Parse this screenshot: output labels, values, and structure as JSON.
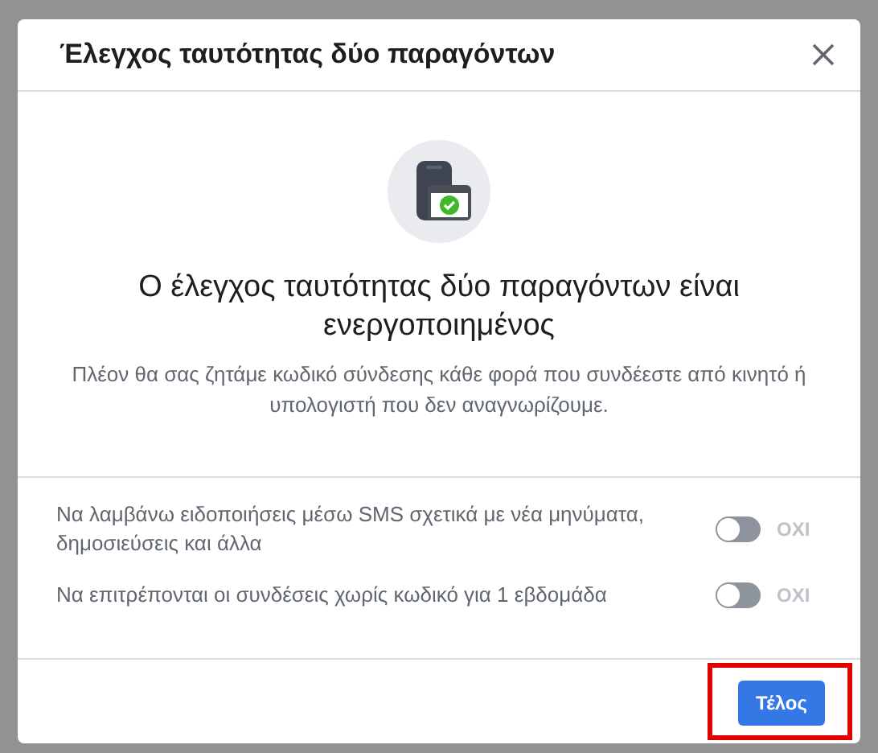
{
  "dialog": {
    "title": "Έλεγχος ταυτότητας δύο παραγόντων",
    "heading": "Ο έλεγχος ταυτότητας δύο παραγόντων είναι ενεργοποιημένος",
    "description": "Πλέον θα σας ζητάμε κωδικό σύνδεσης κάθε φορά που συνδέεστε από κινητό ή υπολογιστή που δεν αναγνωρίζουμε.",
    "settings": [
      {
        "label": "Να λαμβάνω ειδοποιήσεις μέσω SMS σχετικά με νέα μηνύματα, δημοσιεύσεις και άλλα",
        "on": false,
        "state_label": "ΟΧΙ"
      },
      {
        "label": "Να επιτρέπονται οι συνδέσεις χωρίς κωδικό για 1 εβδομάδα",
        "on": false,
        "state_label": "ΟΧΙ"
      }
    ],
    "done_button": {
      "label": "Τέλος",
      "highlighted": true
    }
  }
}
